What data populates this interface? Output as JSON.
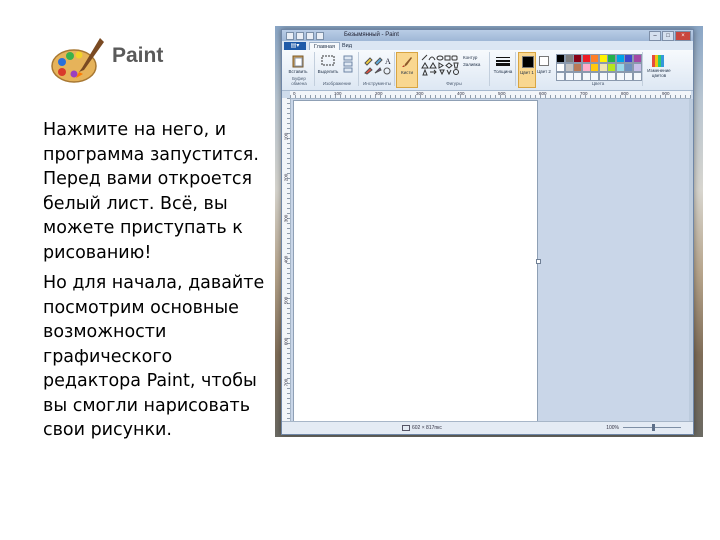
{
  "header": {
    "logo_title": "Paint",
    "logo_icon": "palette-brush-icon"
  },
  "body": {
    "paragraph_1": "Нажмите на него, и программа запустится. Перед вами откроется белый лист. Всё, вы можете приступать к рисованию!",
    "paragraph_2": "Но для начала, давайте посмотрим основные возможности графического редактора Paint, чтобы вы смогли нарисовать свои рисунки."
  },
  "paint_window": {
    "title": "Безымянный - Paint",
    "tabs": [
      "Главная",
      "Вид"
    ],
    "active_tab": "Главная",
    "groups": {
      "clipboard": {
        "paste_label": "Вставить",
        "label": "Буфер обмена"
      },
      "image": {
        "select_label": "Выделить",
        "label": "Изображение"
      },
      "tools": {
        "label": "Инструменты"
      },
      "brushes": {
        "label": "Кисти"
      },
      "shapes": {
        "label": "Фигуры",
        "outline_label": "Контур",
        "fill_label": "Заливка"
      },
      "size": {
        "label": "Толщина"
      },
      "color1": {
        "label": "Цвет 1"
      },
      "color2": {
        "label": "Цвет 2"
      },
      "colors": {
        "label": "Цвета",
        "edit_label": "Изменение цветов"
      }
    },
    "palette": [
      "#000000",
      "#7f7f7f",
      "#880015",
      "#ed1c24",
      "#ff7f27",
      "#fff200",
      "#22b14c",
      "#00a2e8",
      "#3f48cc",
      "#a349a4",
      "#ffffff",
      "#c3c3c3",
      "#b97a57",
      "#ffaec9",
      "#ffc90e",
      "#efe4b0",
      "#b5e61d",
      "#99d9ea",
      "#7092be",
      "#c8bfe7"
    ],
    "ruler_labels": [
      "0",
      "100",
      "200",
      "300",
      "400",
      "500",
      "600",
      "700",
      "800",
      "900"
    ],
    "ruler_v_labels": [
      "100",
      "200",
      "300",
      "400",
      "500",
      "600",
      "700"
    ],
    "status": {
      "dimensions": "602 × 817пкс",
      "zoom": "100%"
    }
  }
}
